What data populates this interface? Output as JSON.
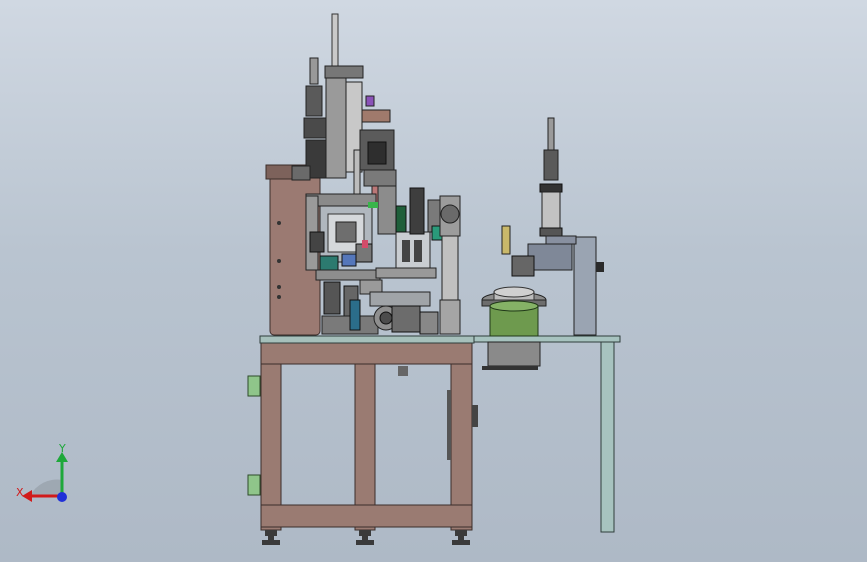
{
  "viewport": {
    "background_top": "#d0d8e2",
    "background_bottom": "#aeb9c6"
  },
  "machine": {
    "frame_color": "#9a7b72",
    "table_top_color": "#a6c0bb",
    "aux_table_color": "#a7c3bf",
    "cabinet_color": "#9b7a72",
    "drum_color": "#6e9a4e"
  },
  "triad": {
    "x_label": "X",
    "y_label": "Y",
    "x_color": "#d11a1a",
    "y_color": "#1ea83a",
    "z_color": "#2030d8"
  }
}
